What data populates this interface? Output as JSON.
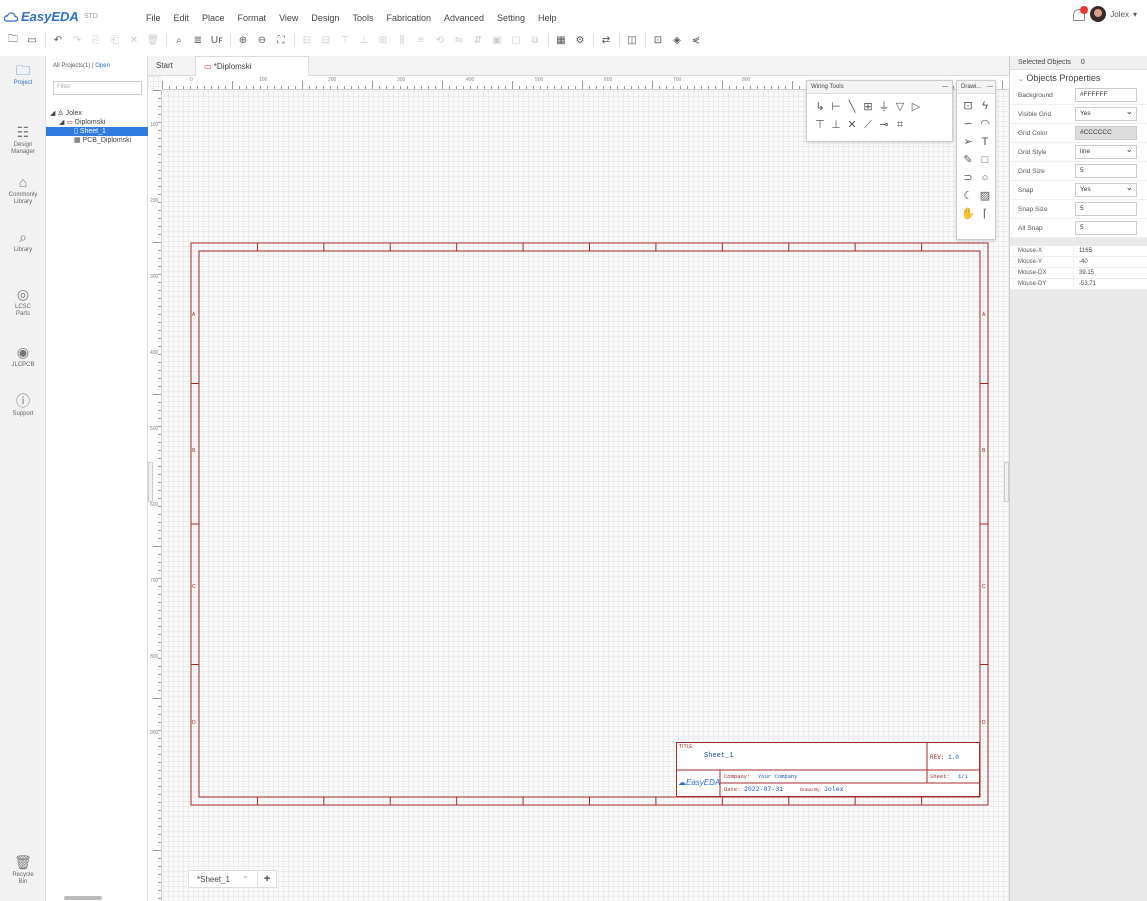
{
  "app": {
    "brand": "EasyEDA",
    "edition": "STD",
    "menu": [
      "File",
      "Edit",
      "Place",
      "Format",
      "View",
      "Design",
      "Tools",
      "Fabrication",
      "Advanced",
      "Setting",
      "Help"
    ],
    "user_name": "Jolex",
    "accent": "#2f6fd0"
  },
  "toolbar": {
    "icons": [
      "new-document",
      "save",
      "undo",
      "redo",
      "copy",
      "paste",
      "cut",
      "delete",
      "zoom-fit",
      "zoom-in",
      "zoom-out",
      "find",
      "align",
      "rotate",
      "flip",
      "netlist",
      "bom",
      "simulation",
      "export",
      "share"
    ]
  },
  "rail": {
    "project": "Project",
    "design_manager": "Design\nManager",
    "commonly_library": "Commonly\nLibrary",
    "library": "Library",
    "lcsc_parts": "LCSC\nParts",
    "jlcpcb": "JLCPCB",
    "support": "Support",
    "recycle_bin": "Recycle\nBin"
  },
  "projects": {
    "tab_all": "All Projects(1)",
    "tab_sep": "|",
    "tab_open": "Open",
    "filter_placeholder": "Filter",
    "tree": {
      "owner": "Jolex",
      "project": "Diplomski",
      "sheet": "Sheet_1",
      "pcb": "PCB_Diplomski"
    }
  },
  "doc_tabs": {
    "start": "Start",
    "current": "*Diplomski"
  },
  "canvas": {
    "ruler_top": [
      "0",
      "100",
      "200",
      "300",
      "400",
      "500",
      "600",
      "700",
      "800"
    ],
    "ruler_left": [
      "100",
      "200",
      "300",
      "400",
      "500",
      "600",
      "700",
      "800",
      "900"
    ],
    "wiring_tools_title": "Wiring Tools",
    "drawing_tools_title": "Drawi...",
    "frame_letters_left": [
      "A",
      "B",
      "C",
      "D"
    ],
    "frame_letters_right": [
      "A",
      "B",
      "C",
      "D"
    ]
  },
  "title_block": {
    "title_label": "TITLE:",
    "title_value": "Sheet_1",
    "rev_label": "REV:",
    "rev_value": "1.0",
    "company_label": "Company:",
    "company_value": "Your Company",
    "sheet_label": "Sheet:",
    "sheet_value": "1/1",
    "date_label": "Date:",
    "date_value": "2022-07-31",
    "drawn_label": "Drawn By:",
    "drawn_value": "Jolex",
    "logo": "EasyEDA",
    "frame_color": "#a52a2a"
  },
  "sheet_tabs": {
    "active": "*Sheet_1",
    "add": "+"
  },
  "right_panel": {
    "selected_objects": "Selected Objects",
    "selected_count": "0",
    "section_title": "Objects Properties",
    "props": [
      {
        "key": "Background",
        "value": "#FFFFFF",
        "select": false
      },
      {
        "key": "Visible Grid",
        "value": "Yes",
        "select": true
      },
      {
        "key": "Grid Color",
        "value": "#CCCCCC",
        "select": false
      },
      {
        "key": "Grid Style",
        "value": "line",
        "select": true
      },
      {
        "key": "Grid Size",
        "value": "5",
        "select": false
      },
      {
        "key": "Snap",
        "value": "Yes",
        "select": true
      },
      {
        "key": "Snap Size",
        "value": "5",
        "select": false
      },
      {
        "key": "Alt Snap",
        "value": "5",
        "select": false
      }
    ],
    "mouse": [
      {
        "key": "Mouse-X",
        "value": "1165"
      },
      {
        "key": "Mouse-Y",
        "value": "-40"
      },
      {
        "key": "Mouse-DX",
        "value": "39.15"
      },
      {
        "key": "Mouse-DY",
        "value": "-53.71"
      }
    ]
  }
}
